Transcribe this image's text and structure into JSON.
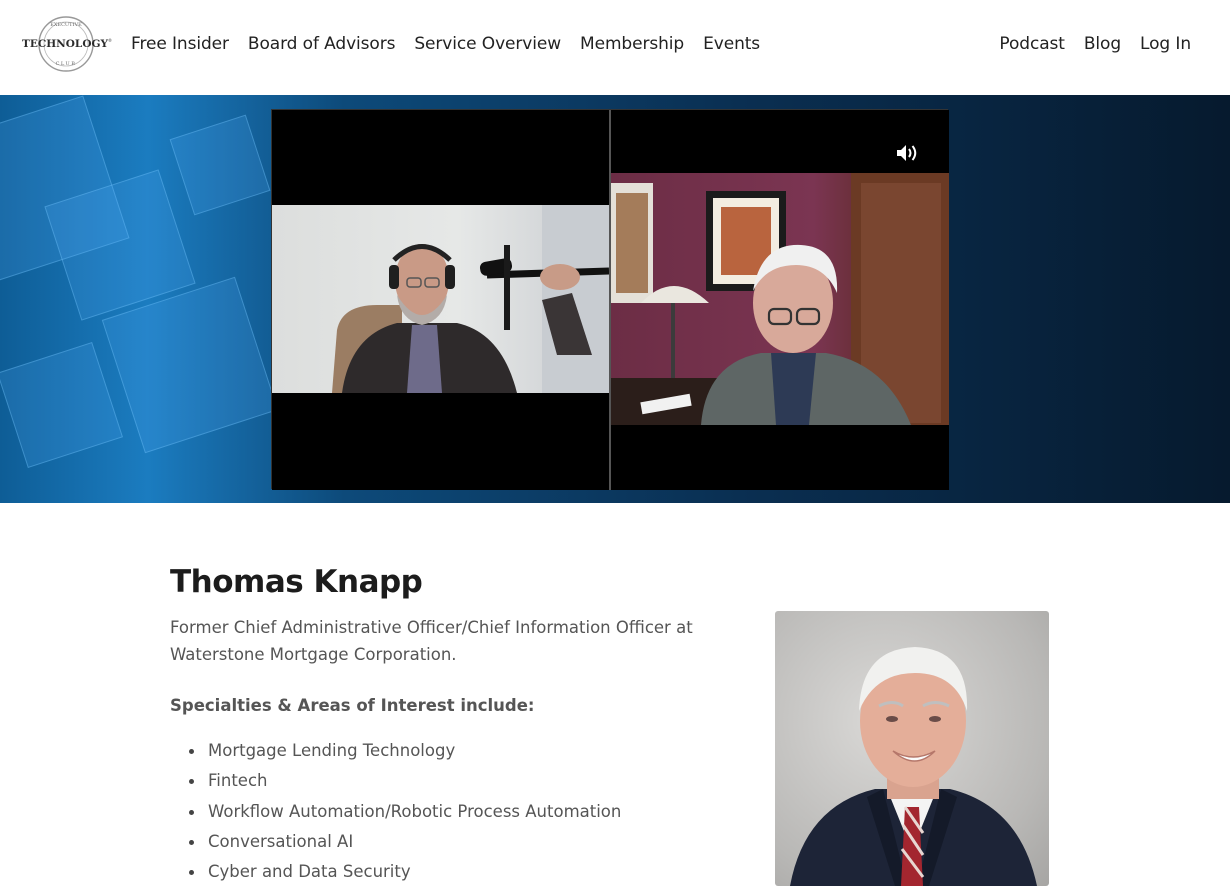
{
  "brand": {
    "logo_top": "EXECUTIVE",
    "logo_main": "TECHNOLOGY",
    "logo_mark": "®",
    "logo_bottom": "CLUB"
  },
  "nav": {
    "left": [
      "Free Insider",
      "Board of Advisors",
      "Service Overview",
      "Membership",
      "Events"
    ],
    "right": [
      "Podcast",
      "Blog",
      "Log In"
    ]
  },
  "video": {
    "sound_icon": "speaker-volume-icon"
  },
  "profile": {
    "name": "Thomas Knapp",
    "role": "Former Chief Administrative Officer/Chief Information Officer at Waterstone Mortgage Corporation.",
    "specialties_title": "Specialties & Areas of Interest include:",
    "specialties": [
      "Mortgage Lending Technology",
      "Fintech",
      "Workflow Automation/Robotic Process Automation",
      "Conversational AI",
      "Cyber and Data Security"
    ]
  },
  "colors": {
    "hero_accent": "#1b7cc0",
    "hero_dark": "#061a2e",
    "text": "#555555",
    "heading": "#1c1c1c"
  }
}
